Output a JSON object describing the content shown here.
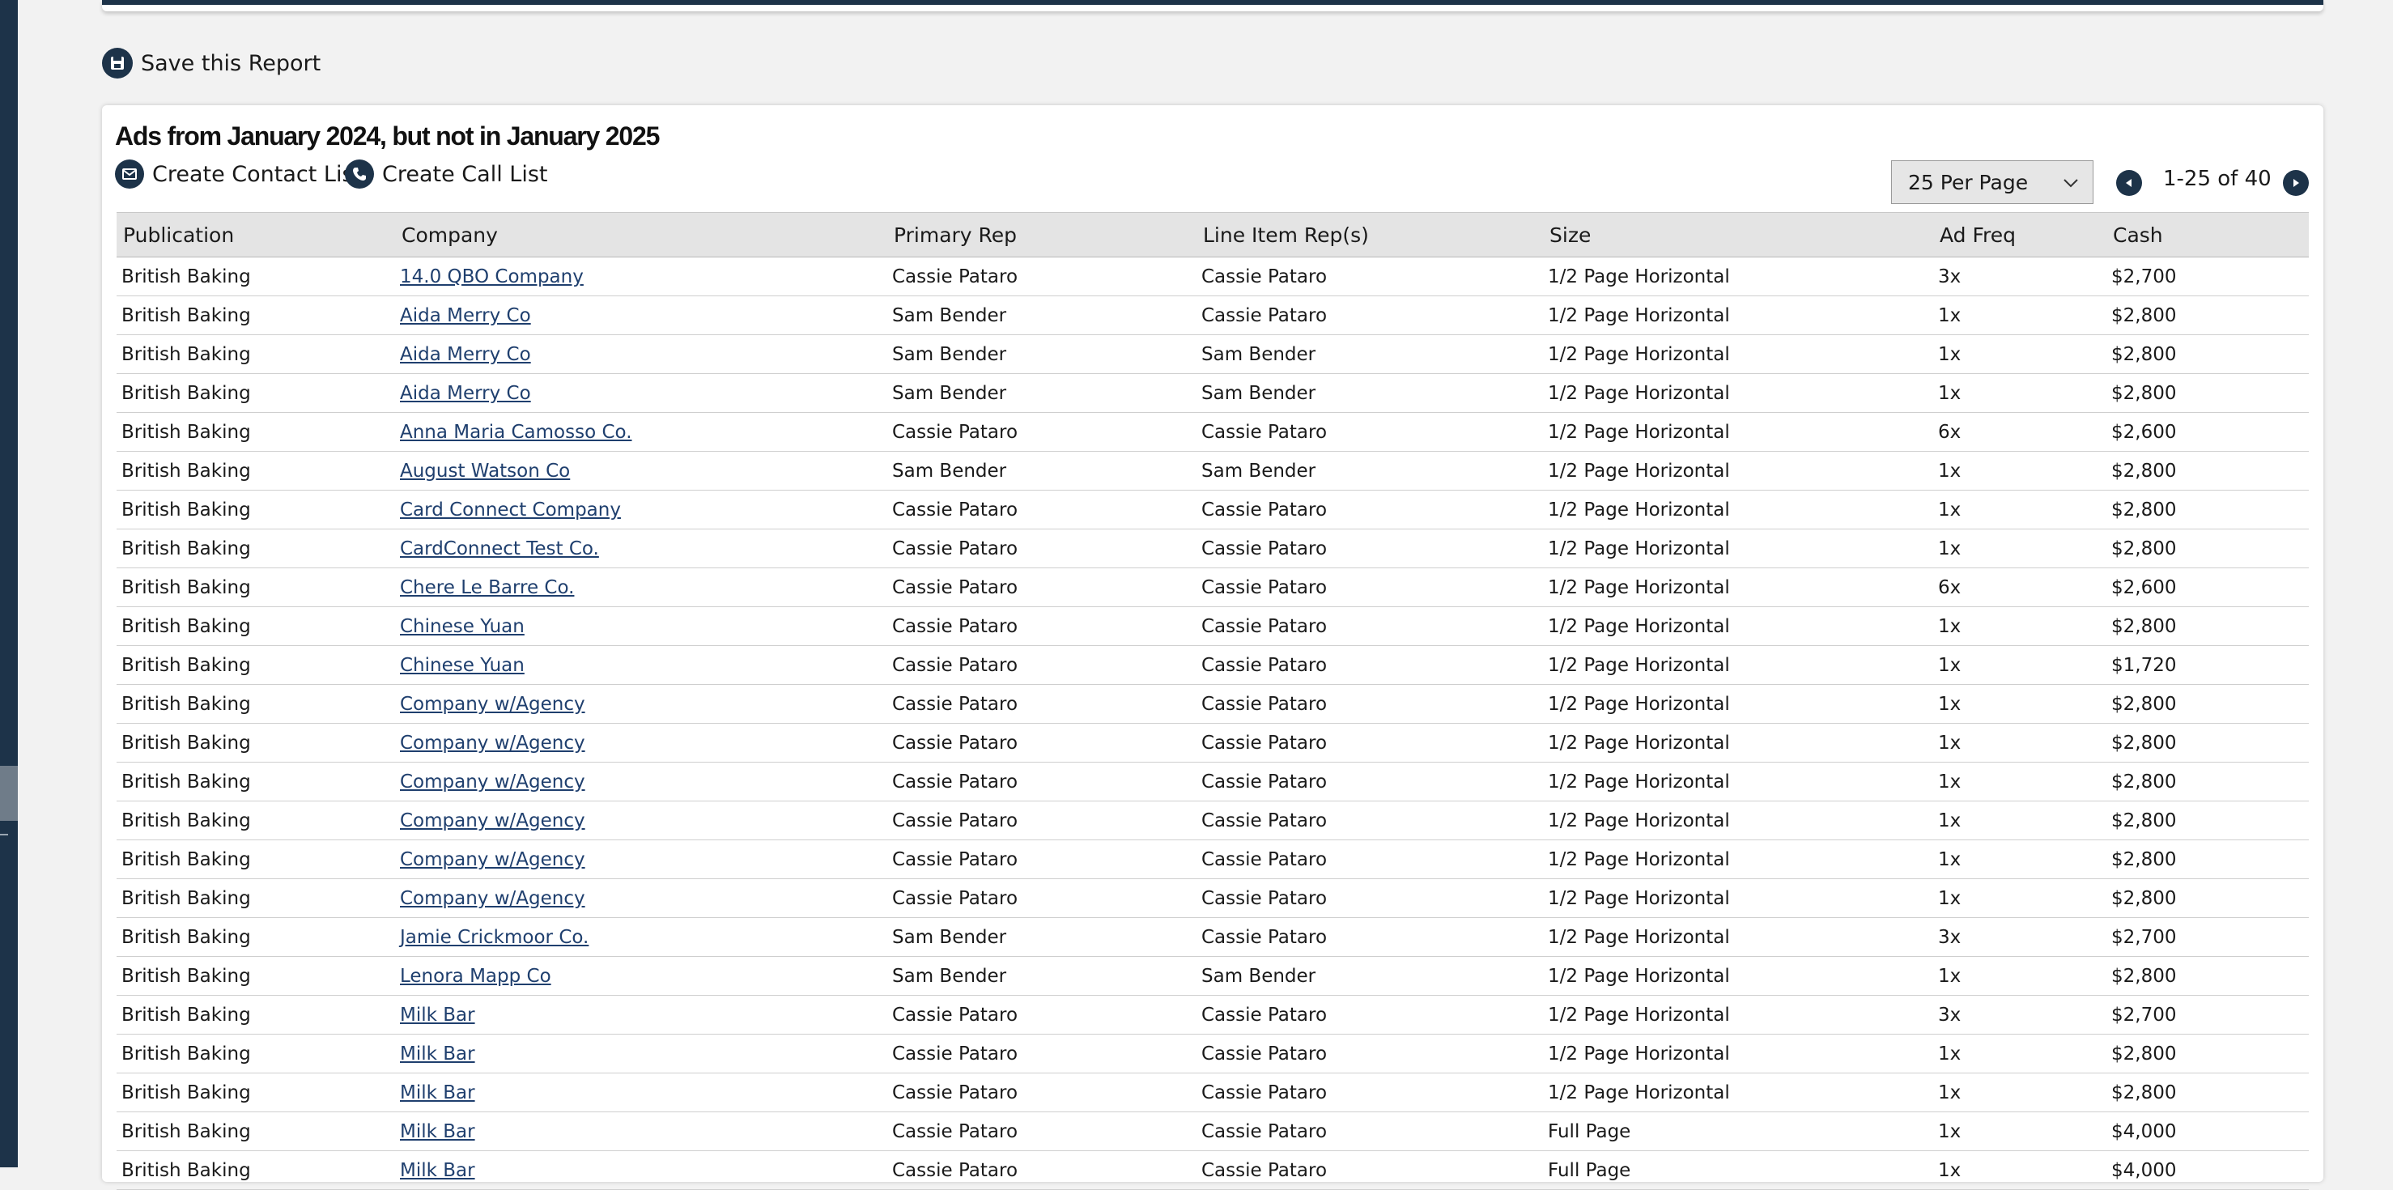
{
  "save_report_label": "Save this Report",
  "report": {
    "title": "Ads from January 2024, but not in January 2025",
    "create_contact_list": "Create Contact List",
    "create_call_list": "Create Call List",
    "per_page": "25 Per Page",
    "pagination": "1-25 of 40"
  },
  "columns": [
    "Publication",
    "Company",
    "Primary Rep",
    "Line Item Rep(s)",
    "Size",
    "Ad Freq",
    "Cash"
  ],
  "rows": [
    [
      "British Baking",
      "14.0 QBO Company",
      "Cassie Pataro",
      "Cassie Pataro",
      "1/2 Page Horizontal",
      "3x",
      "$2,700"
    ],
    [
      "British Baking",
      "Aida Merry Co",
      "Sam Bender",
      "Cassie Pataro",
      "1/2 Page Horizontal",
      "1x",
      "$2,800"
    ],
    [
      "British Baking",
      "Aida Merry Co",
      "Sam Bender",
      "Sam Bender",
      "1/2 Page Horizontal",
      "1x",
      "$2,800"
    ],
    [
      "British Baking",
      "Aida Merry Co",
      "Sam Bender",
      "Sam Bender",
      "1/2 Page Horizontal",
      "1x",
      "$2,800"
    ],
    [
      "British Baking",
      "Anna Maria Camosso Co.",
      "Cassie Pataro",
      "Cassie Pataro",
      "1/2 Page Horizontal",
      "6x",
      "$2,600"
    ],
    [
      "British Baking",
      "August Watson Co",
      "Sam Bender",
      "Sam Bender",
      "1/2 Page Horizontal",
      "1x",
      "$2,800"
    ],
    [
      "British Baking",
      "Card Connect Company",
      "Cassie Pataro",
      "Cassie Pataro",
      "1/2 Page Horizontal",
      "1x",
      "$2,800"
    ],
    [
      "British Baking",
      "CardConnect Test Co.",
      "Cassie Pataro",
      "Cassie Pataro",
      "1/2 Page Horizontal",
      "1x",
      "$2,800"
    ],
    [
      "British Baking",
      "Chere Le Barre Co.",
      "Cassie Pataro",
      "Cassie Pataro",
      "1/2 Page Horizontal",
      "6x",
      "$2,600"
    ],
    [
      "British Baking",
      "Chinese Yuan",
      "Cassie Pataro",
      "Cassie Pataro",
      "1/2 Page Horizontal",
      "1x",
      "$2,800"
    ],
    [
      "British Baking",
      "Chinese Yuan",
      "Cassie Pataro",
      "Cassie Pataro",
      "1/2 Page Horizontal",
      "1x",
      "$1,720"
    ],
    [
      "British Baking",
      "Company w/Agency",
      "Cassie Pataro",
      "Cassie Pataro",
      "1/2 Page Horizontal",
      "1x",
      "$2,800"
    ],
    [
      "British Baking",
      "Company w/Agency",
      "Cassie Pataro",
      "Cassie Pataro",
      "1/2 Page Horizontal",
      "1x",
      "$2,800"
    ],
    [
      "British Baking",
      "Company w/Agency",
      "Cassie Pataro",
      "Cassie Pataro",
      "1/2 Page Horizontal",
      "1x",
      "$2,800"
    ],
    [
      "British Baking",
      "Company w/Agency",
      "Cassie Pataro",
      "Cassie Pataro",
      "1/2 Page Horizontal",
      "1x",
      "$2,800"
    ],
    [
      "British Baking",
      "Company w/Agency",
      "Cassie Pataro",
      "Cassie Pataro",
      "1/2 Page Horizontal",
      "1x",
      "$2,800"
    ],
    [
      "British Baking",
      "Company w/Agency",
      "Cassie Pataro",
      "Cassie Pataro",
      "1/2 Page Horizontal",
      "1x",
      "$2,800"
    ],
    [
      "British Baking",
      "Jamie Crickmoor Co.",
      "Sam Bender",
      "Cassie Pataro",
      "1/2 Page Horizontal",
      "3x",
      "$2,700"
    ],
    [
      "British Baking",
      "Lenora Mapp Co",
      "Sam Bender",
      "Sam Bender",
      "1/2 Page Horizontal",
      "1x",
      "$2,800"
    ],
    [
      "British Baking",
      "Milk Bar",
      "Cassie Pataro",
      "Cassie Pataro",
      "1/2 Page Horizontal",
      "3x",
      "$2,700"
    ],
    [
      "British Baking",
      "Milk Bar",
      "Cassie Pataro",
      "Cassie Pataro",
      "1/2 Page Horizontal",
      "1x",
      "$2,800"
    ],
    [
      "British Baking",
      "Milk Bar",
      "Cassie Pataro",
      "Cassie Pataro",
      "1/2 Page Horizontal",
      "1x",
      "$2,800"
    ],
    [
      "British Baking",
      "Milk Bar",
      "Cassie Pataro",
      "Cassie Pataro",
      "Full Page",
      "1x",
      "$4,000"
    ],
    [
      "British Baking",
      "Milk Bar",
      "Cassie Pataro",
      "Cassie Pataro",
      "Full Page",
      "1x",
      "$4,000"
    ]
  ]
}
